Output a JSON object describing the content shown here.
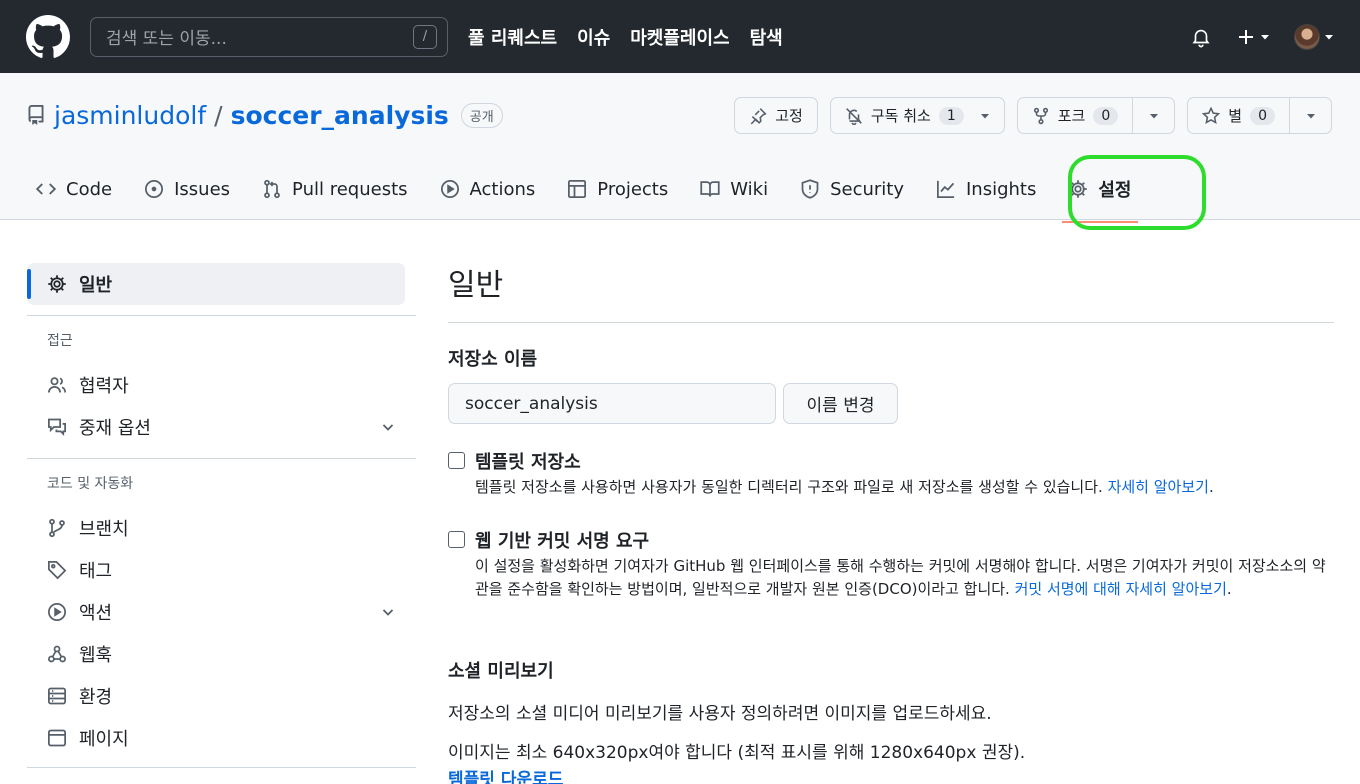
{
  "header": {
    "search_placeholder": "검색 또는 이동...",
    "search_key": "/",
    "nav": [
      "풀 리퀘스트",
      "이슈",
      "마켓플레이스",
      "탐색"
    ]
  },
  "repo": {
    "owner": "jasminludolf",
    "separator": "/",
    "name": "soccer_analysis",
    "visibility": "공개",
    "pin_label": "고정",
    "watch_label": "구독 취소",
    "watch_count": "1",
    "fork_label": "포크",
    "fork_count": "0",
    "star_label": "별",
    "star_count": "0"
  },
  "tabs": [
    {
      "label": "Code",
      "icon": "code-icon"
    },
    {
      "label": "Issues",
      "icon": "issue-icon"
    },
    {
      "label": "Pull requests",
      "icon": "pull-request-icon"
    },
    {
      "label": "Actions",
      "icon": "play-icon"
    },
    {
      "label": "Projects",
      "icon": "table-icon"
    },
    {
      "label": "Wiki",
      "icon": "book-icon"
    },
    {
      "label": "Security",
      "icon": "shield-icon"
    },
    {
      "label": "Insights",
      "icon": "graph-icon"
    },
    {
      "label": "설정",
      "icon": "gear-icon",
      "active": true
    }
  ],
  "sidebar": {
    "active_label": "일반",
    "section_access": "접근",
    "collaborators": "협력자",
    "moderation": "중재 옵션",
    "section_code": "코드 및 자동화",
    "branches": "브랜치",
    "tags": "태그",
    "actions": "액션",
    "webhooks": "웹훅",
    "environments": "환경",
    "pages": "페이지"
  },
  "main": {
    "title": "일반",
    "repo_name_label": "저장소 이름",
    "repo_name_value": "soccer_analysis",
    "rename_button": "이름 변경",
    "template_title": "템플릿 저장소",
    "template_desc": "템플릿 저장소를 사용하면 사용자가 동일한 디렉터리 구조와 파일로 새 저장소를 생성할 수 있습니다. ",
    "template_link": "자세히 알아보기",
    "template_after": ".",
    "signoff_title": "웹 기반 커밋 서명 요구",
    "signoff_desc": "이 설정을 활성화하면 기여자가 GitHub 웹 인터페이스를 통해 수행하는 커밋에 서명해야 합니다. 서명은 기여자가 커밋이 저장소소의 약관을 준수함을 확인하는 방법이며, 일반적으로 개발자 원본 인증(DCO)이라고 합니다. ",
    "signoff_link": "커밋 서명에 대해 자세히 알아보기",
    "signoff_after": ".",
    "social_title": "소셜 미리보기",
    "social_desc": "저장소의 소셜 미디어 미리보기를 사용자 정의하려면 이미지를 업로드하세요.",
    "social_size": "이미지는 최소 640x320px여야 합니다 (최적 표시를 위해 1280x640px 권장).",
    "template_download": "템플릿 다운로드"
  }
}
